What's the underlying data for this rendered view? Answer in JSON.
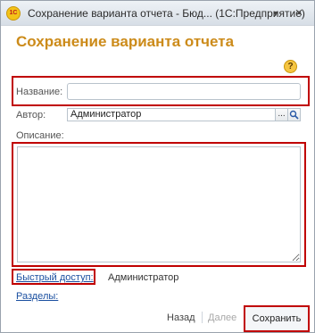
{
  "window": {
    "title": "Сохранение варианта отчета - Бюд...  (1С:Предприятие)",
    "app_icon_text": "1С",
    "menu_glyph": "▼",
    "close_glyph": "×"
  },
  "form": {
    "title": "Сохранение варианта отчета",
    "help_glyph": "?",
    "name_label": "Название:",
    "name_value": "",
    "author_label": "Автор:",
    "author_value": "Администратор",
    "author_select_glyph": "...",
    "author_open_glyph": "🔍",
    "description_label": "Описание:",
    "description_value": "",
    "quick_access_label": "Быстрый доступ:",
    "quick_access_value": "Администратор",
    "sections_label": "Разделы:"
  },
  "footer": {
    "back_label": "Назад",
    "next_label": "Далее",
    "save_label": "Сохранить"
  },
  "colors": {
    "title_accent": "#cc8b1a",
    "highlight": "#c00000",
    "link": "#1a4fa0"
  }
}
